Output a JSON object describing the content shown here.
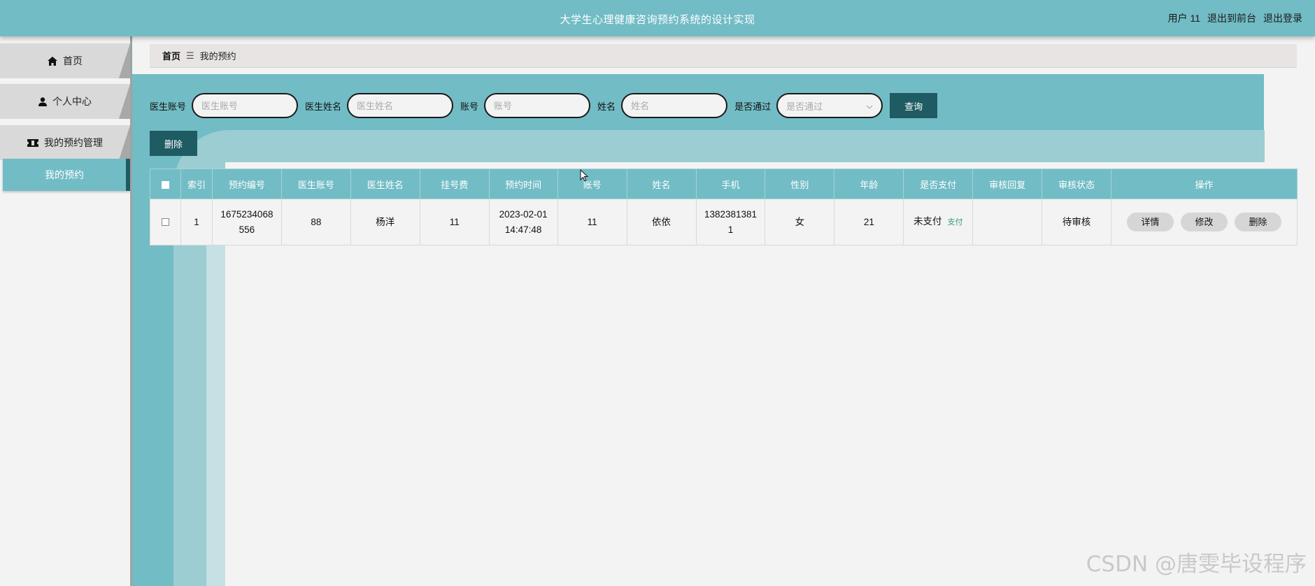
{
  "header": {
    "title": "大学生心理健康咨询预约系统的设计实现",
    "user_label": "用户 11",
    "back_to_front": "退出到前台",
    "logout": "退出登录"
  },
  "sidebar": {
    "items": [
      {
        "label": "首页",
        "icon": "home-icon"
      },
      {
        "label": "个人中心",
        "icon": "user-icon"
      },
      {
        "label": "我的预约管理",
        "icon": "ticket-icon"
      }
    ],
    "active_subitem": "我的预约"
  },
  "breadcrumb": {
    "home": "首页",
    "separator": "☰",
    "current": "我的预约"
  },
  "search": {
    "fields": [
      {
        "label": "医生账号",
        "placeholder": "医生账号"
      },
      {
        "label": "医生姓名",
        "placeholder": "医生姓名"
      },
      {
        "label": "账号",
        "placeholder": "账号"
      },
      {
        "label": "姓名",
        "placeholder": "姓名"
      }
    ],
    "select": {
      "label": "是否通过",
      "placeholder": "是否通过"
    },
    "query_label": "查询"
  },
  "actions": {
    "delete_label": "删除"
  },
  "table": {
    "headers": [
      "索引",
      "预约编号",
      "医生账号",
      "医生姓名",
      "挂号费",
      "预约时间",
      "账号",
      "姓名",
      "手机",
      "性别",
      "年龄",
      "是否支付",
      "审核回复",
      "审核状态",
      "操作"
    ],
    "rows": [
      {
        "index": "1",
        "order_no": "1675234068556",
        "doctor_account": "88",
        "doctor_name": "杨洋",
        "fee": "11",
        "time": "2023-02-01 14:47:48",
        "account": "11",
        "name": "依依",
        "phone": "13823813811",
        "gender": "女",
        "age": "21",
        "paid": "未支付",
        "pay_link": "支付",
        "review_reply": "",
        "review_status": "待审核",
        "ops": [
          "详情",
          "修改",
          "删除"
        ]
      }
    ]
  },
  "watermark": "CSDN @唐雯毕设程序",
  "colors": {
    "primary": "#72bcc5",
    "dark": "#1f5b63",
    "pay_link": "#2e9e78"
  }
}
